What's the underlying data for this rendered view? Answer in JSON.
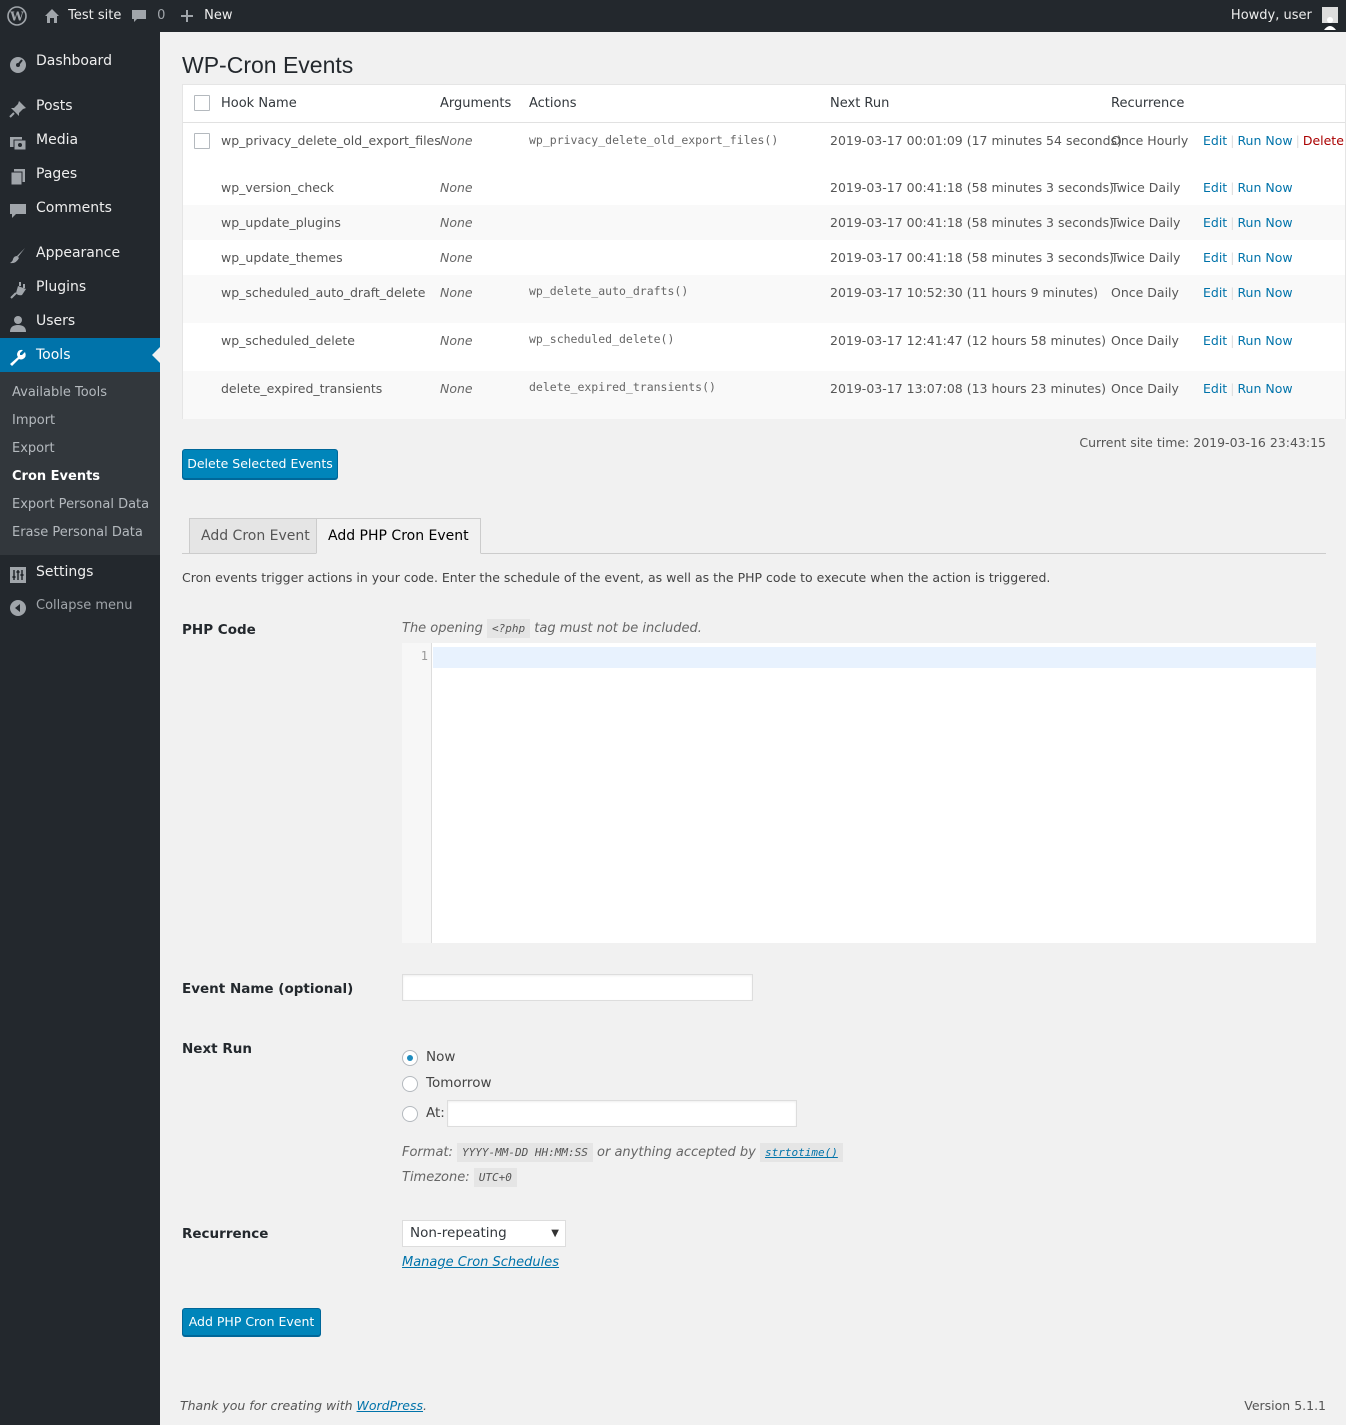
{
  "adminbar": {
    "site_name": "Test site",
    "comments_count": "0",
    "new_label": "New",
    "howdy": "Howdy, user"
  },
  "sidebar": {
    "items": [
      {
        "label": "Dashboard",
        "icon": "dashboard-icon"
      },
      {
        "label": "Posts",
        "icon": "pin-icon"
      },
      {
        "label": "Media",
        "icon": "media-icon"
      },
      {
        "label": "Pages",
        "icon": "pages-icon"
      },
      {
        "label": "Comments",
        "icon": "comment-icon"
      },
      {
        "label": "Appearance",
        "icon": "brush-icon"
      },
      {
        "label": "Plugins",
        "icon": "plug-icon"
      },
      {
        "label": "Users",
        "icon": "user-icon"
      },
      {
        "label": "Tools",
        "icon": "wrench-icon"
      },
      {
        "label": "Settings",
        "icon": "settings-icon"
      },
      {
        "label": "Collapse menu",
        "icon": "collapse-icon"
      }
    ],
    "submenu": [
      "Available Tools",
      "Import",
      "Export",
      "Cron Events",
      "Export Personal Data",
      "Erase Personal Data"
    ]
  },
  "page": {
    "title": "WP-Cron Events",
    "columns": [
      "Hook Name",
      "Arguments",
      "Actions",
      "Next Run",
      "Recurrence"
    ],
    "rows": [
      {
        "hook": "wp_privacy_delete_old_export_files",
        "args": "None",
        "action": "wp_privacy_delete_old_export_files()",
        "next": "2019-03-17 00:01:09 (17 minutes 54 seconds)",
        "rec": "Once Hourly",
        "deletable": true
      },
      {
        "hook": "wp_version_check",
        "args": "None",
        "action": "",
        "next": "2019-03-17 00:41:18 (58 minutes 3 seconds)",
        "rec": "Twice Daily"
      },
      {
        "hook": "wp_update_plugins",
        "args": "None",
        "action": "",
        "next": "2019-03-17 00:41:18 (58 minutes 3 seconds)",
        "rec": "Twice Daily"
      },
      {
        "hook": "wp_update_themes",
        "args": "None",
        "action": "",
        "next": "2019-03-17 00:41:18 (58 minutes 3 seconds)",
        "rec": "Twice Daily"
      },
      {
        "hook": "wp_scheduled_auto_draft_delete",
        "args": "None",
        "action": "wp_delete_auto_drafts()",
        "next": "2019-03-17 10:52:30 (11 hours 9 minutes)",
        "rec": "Once Daily"
      },
      {
        "hook": "wp_scheduled_delete",
        "args": "None",
        "action": "wp_scheduled_delete()",
        "next": "2019-03-17 12:41:47 (12 hours 58 minutes)",
        "rec": "Once Daily"
      },
      {
        "hook": "delete_expired_transients",
        "args": "None",
        "action": "delete_expired_transients()",
        "next": "2019-03-17 13:07:08 (13 hours 23 minutes)",
        "rec": "Once Daily"
      }
    ],
    "row_links": {
      "edit": "Edit",
      "run": "Run Now",
      "delete": "Delete"
    },
    "site_time": "Current site time: 2019-03-16 23:43:15",
    "delete_selected": "Delete Selected Events"
  },
  "tabs": [
    "Add Cron Event",
    "Add PHP Cron Event"
  ],
  "form": {
    "description": "Cron events trigger actions in your code. Enter the schedule of the event, as well as the PHP code to execute when the action is triggered.",
    "php_code_label": "PHP Code",
    "php_hint_pre": "The opening",
    "php_hint_tag": "<?php",
    "php_hint_post": "tag must not be included.",
    "line_number": "1",
    "event_name_label": "Event Name (optional)",
    "next_run_label": "Next Run",
    "radio_now": "Now",
    "radio_tomorrow": "Tomorrow",
    "radio_at": "At:",
    "format_pre": "Format:",
    "format_code": "YYYY-MM-DD HH:MM:SS",
    "format_mid": "or anything accepted by",
    "format_link": "strtotime()",
    "timezone_label": "Timezone:",
    "timezone_code": "UTC+0",
    "recurrence_label": "Recurrence",
    "recurrence_value": "Non-repeating",
    "manage_link": "Manage Cron Schedules",
    "submit": "Add PHP Cron Event"
  },
  "footer": {
    "thanks_pre": "Thank you for creating with",
    "thanks_link": "WordPress",
    "thanks_post": ".",
    "version": "Version 5.1.1"
  },
  "colors": {
    "accent": "#0073aa",
    "adminbar": "#23282d",
    "delete": "#a00000"
  }
}
